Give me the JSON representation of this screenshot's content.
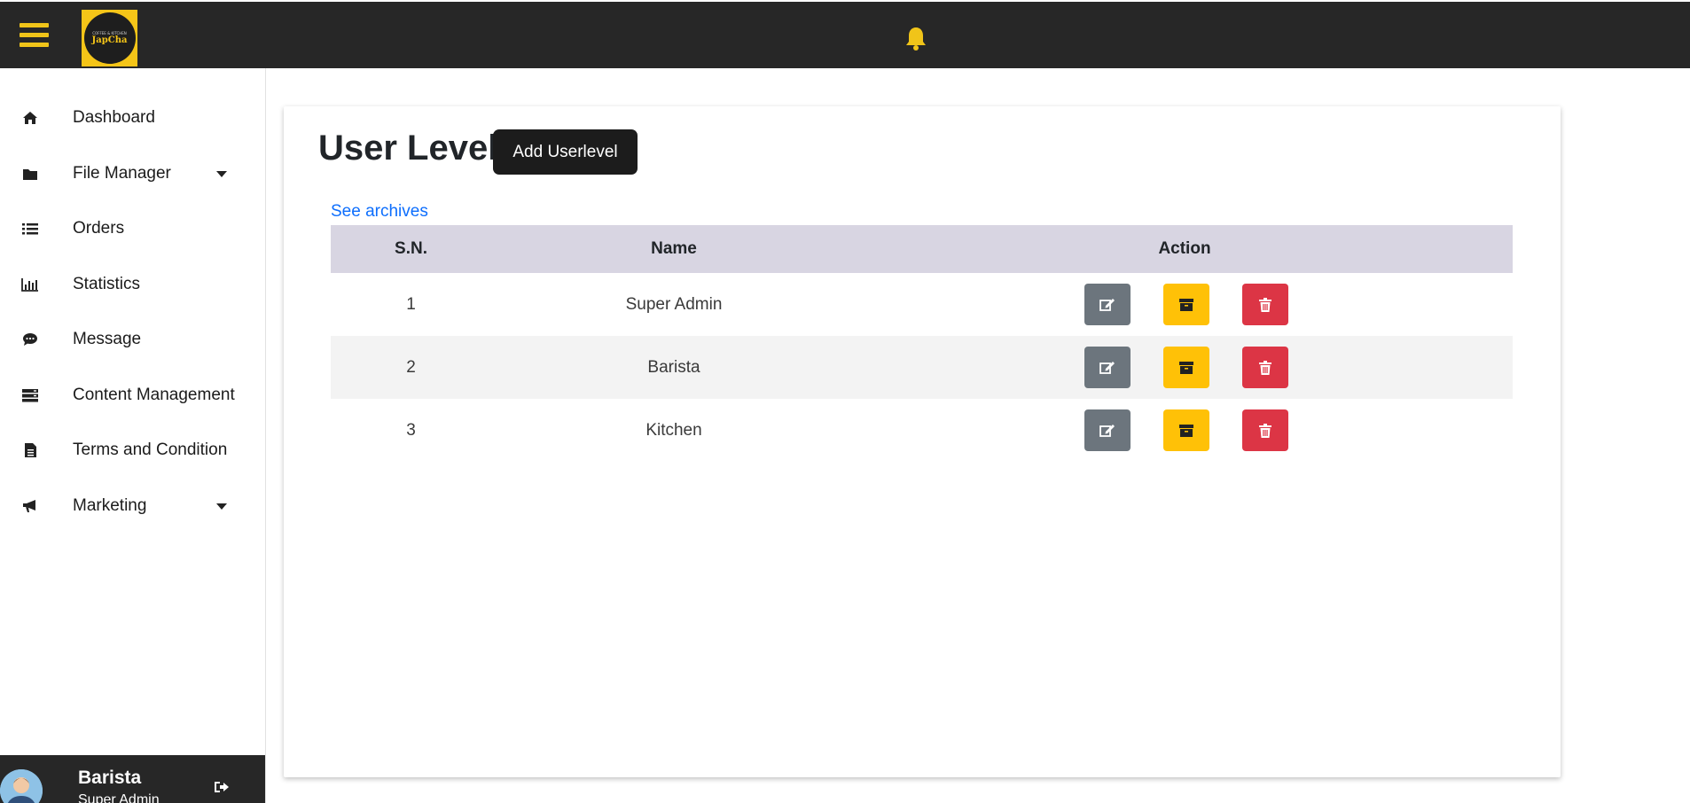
{
  "brand": {
    "logo_tagline": "COFFEE & KITCHEN",
    "logo_name": "JapCha",
    "colors": {
      "accent": "#f0c419",
      "topbar": "#272727"
    }
  },
  "sidebar": {
    "items": [
      {
        "label": "Dashboard",
        "icon": "home-icon",
        "has_dropdown": false
      },
      {
        "label": "File Manager",
        "icon": "folder-icon",
        "has_dropdown": true
      },
      {
        "label": "Orders",
        "icon": "list-icon",
        "has_dropdown": false
      },
      {
        "label": "Statistics",
        "icon": "bar-chart-icon",
        "has_dropdown": false
      },
      {
        "label": "Message",
        "icon": "comment-icon",
        "has_dropdown": false
      },
      {
        "label": "Content Management",
        "icon": "server-icon",
        "has_dropdown": false
      },
      {
        "label": "Terms and Condition",
        "icon": "file-text-icon",
        "has_dropdown": false
      },
      {
        "label": "Marketing",
        "icon": "bullhorn-icon",
        "has_dropdown": true
      }
    ],
    "user": {
      "name": "Barista",
      "role": "Super Admin"
    }
  },
  "main": {
    "title": "User Level",
    "add_button": "Add Userlevel",
    "archives_link": "See archives",
    "table": {
      "headers": [
        "S.N.",
        "Name",
        "Action"
      ],
      "rows": [
        {
          "sn": "1",
          "name": "Super Admin"
        },
        {
          "sn": "2",
          "name": "Barista"
        },
        {
          "sn": "3",
          "name": "Kitchen"
        }
      ],
      "action_colors": {
        "edit": "#6c757d",
        "archive": "#ffc107",
        "delete": "#dc3545"
      }
    }
  }
}
